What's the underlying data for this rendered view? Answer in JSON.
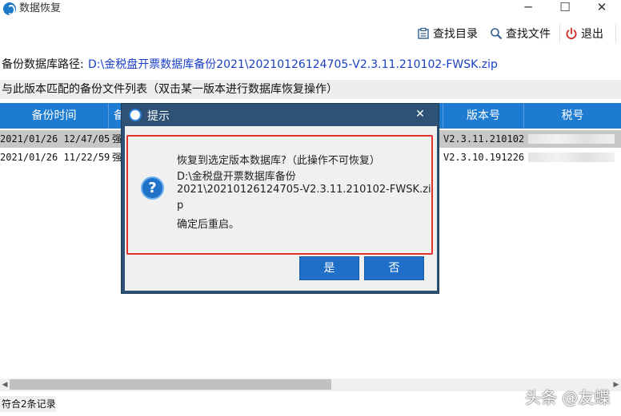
{
  "window": {
    "title": "数据恢复",
    "minimize_glyph": "─",
    "maximize_glyph": "☐",
    "close_glyph": "✕"
  },
  "toolbar": {
    "find_dir": {
      "label": "查找目录",
      "icon": "folder-list-icon"
    },
    "find_file": {
      "label": "查找文件",
      "icon": "search-icon"
    },
    "exit": {
      "label": "退出",
      "icon": "power-icon",
      "icon_color": "#d42a2a"
    }
  },
  "path": {
    "label": "备份数据库路径:",
    "value": "D:\\金税盘开票数据库备份2021\\20210126124705-V2.3.11.210102-FWSK.zip"
  },
  "list": {
    "caption": "与此版本匹配的备份文件列表（双击某一版本进行数据库恢复操作）",
    "columns": [
      "备份时间",
      "备",
      "版本号",
      "税号"
    ],
    "rows": [
      {
        "time": "2021/01/26 12/47/05",
        "type": "强",
        "version": "V2.3.11.210102"
      },
      {
        "time": "2021/01/26 11/22/59",
        "type": "强",
        "version": "V2.3.10.191226"
      }
    ]
  },
  "status": {
    "text": "符合2条记录"
  },
  "watermark": "头条 @友蝶",
  "colors": {
    "header_blue": "#1d7bd1",
    "dialog_frame": "#2e5276",
    "button_blue": "#1f6fc8",
    "highlight_red": "#e0312d"
  },
  "dialog": {
    "title": "提示",
    "close_glyph": "✕",
    "icon": "question-icon",
    "question_glyph": "?",
    "message": {
      "line1": "恢复到选定版本数据库?（此操作不可恢复）",
      "line2": "D:\\金税盘开票数据库备份",
      "line3": "2021\\20210126124705-V2.3.11.210102-FWSK.zi",
      "line4": "p",
      "line5": "确定后重启。"
    },
    "yes_label": "是",
    "no_label": "否"
  }
}
